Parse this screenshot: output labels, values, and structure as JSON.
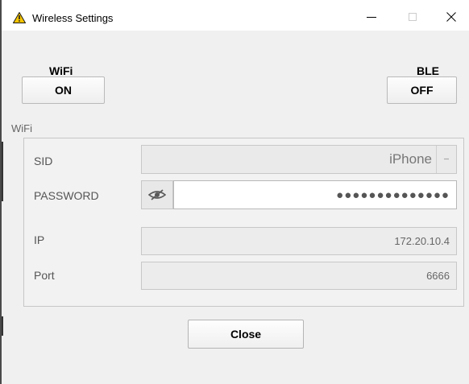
{
  "window": {
    "title": "Wireless Settings",
    "icon": "warning-triangle-icon",
    "controls": {
      "minimize": "minimize-icon",
      "maximize": "maximize-icon",
      "close": "close-icon"
    }
  },
  "toggles": {
    "wifi": {
      "label": "WiFi",
      "state": "ON"
    },
    "ble": {
      "label": "BLE",
      "state": "OFF"
    }
  },
  "wifi_section": {
    "title": "WiFi",
    "sid": {
      "label": "SID",
      "value": "iPhone"
    },
    "password": {
      "label": "PASSWORD",
      "value": "●●●●●●●●●●●●●●",
      "toggle_icon": "eye-slash-icon"
    },
    "ip": {
      "label": "IP",
      "value": "172.20.10.4"
    },
    "port": {
      "label": "Port",
      "value": "6666"
    }
  },
  "actions": {
    "close_label": "Close"
  },
  "colors": {
    "window_bg": "#f0f0f0",
    "titlebar_bg": "#ffffff",
    "icon_yellow": "#f5c400"
  }
}
